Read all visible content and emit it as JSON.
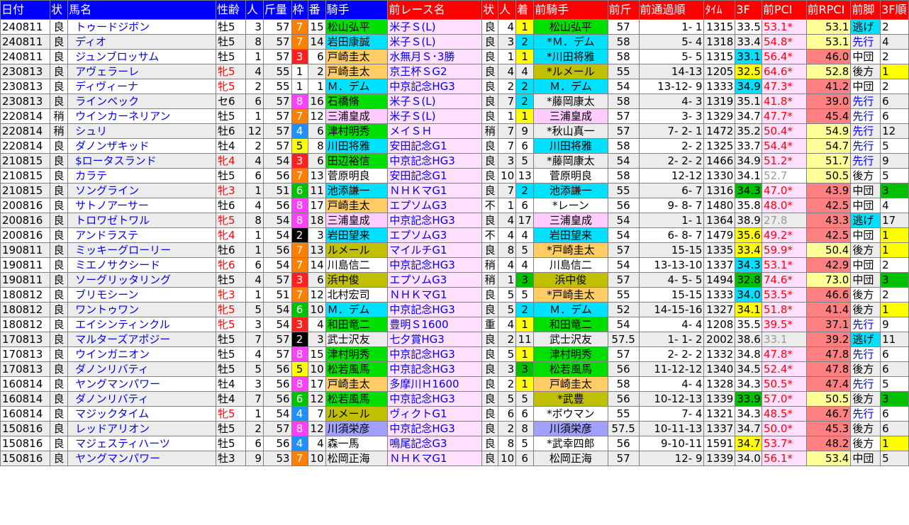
{
  "headers": [
    "日付",
    "状",
    "馬名",
    "性齢",
    "人",
    "斤量",
    "枠",
    "番",
    "騎手",
    "前レース名",
    "状",
    "人",
    "着",
    "前騎手",
    "前斤",
    "前通過順",
    "ﾀｲﾑ",
    "3F",
    "前PCI",
    "前RPCI",
    "前脚",
    "3F順"
  ],
  "rows": [
    {
      "date": "240811",
      "cond": "良",
      "name": "トゥードジボン",
      "age": "牡5",
      "mare": false,
      "pop": "3",
      "wt": "57",
      "frame": "7",
      "no": "15",
      "jockey": "松山弘平",
      "jc": "#00e000",
      "race": "米子Ｓ(L)",
      "pcond": "良",
      "ppop": "4",
      "fin": "1",
      "finc": "#ffff00",
      "pjockey": "松山弘平",
      "pjc": "#00e000",
      "pwt": "57",
      "pass": "1- 1",
      "time": "1315",
      "f3": "33.5",
      "f3c": "",
      "pci": "53.1*",
      "pcihi": true,
      "rpci": "53.1",
      "rpc": "#ffff99",
      "pos": "逃げ",
      "posc": "#00e0ff",
      "f3r": "2",
      "f3rc": ""
    },
    {
      "date": "240811",
      "cond": "良",
      "name": "ディオ",
      "age": "牡5",
      "mare": false,
      "pop": "8",
      "wt": "57",
      "frame": "7",
      "no": "14",
      "jockey": "岩田康誠",
      "jc": "#00e0ff",
      "race": "米子Ｓ(L)",
      "pcond": "良",
      "ppop": "3",
      "fin": "2",
      "finc": "#00e0ff",
      "pjockey": "*Ｍ．デム",
      "pjc": "#00e0ff",
      "pwt": "58",
      "pass": "5- 4",
      "time": "1318",
      "f3": "33.4",
      "f3c": "",
      "pci": "54.8*",
      "pcihi": true,
      "rpci": "53.1",
      "rpc": "#ffff99",
      "pos": "先行",
      "posc": "",
      "f3r": "4",
      "f3rc": ""
    },
    {
      "date": "240811",
      "cond": "良",
      "name": "ジュンブロッサム",
      "age": "牡5",
      "mare": false,
      "pop": "1",
      "wt": "57",
      "frame": "3",
      "no": "6",
      "jockey": "戸崎圭太",
      "jc": "#ffcc66",
      "race": "水無月Ｓ･3勝",
      "pcond": "良",
      "ppop": "1",
      "fin": "1",
      "finc": "#ffff00",
      "pjockey": "*川田将雅",
      "pjc": "#00e0ff",
      "pwt": "58",
      "pass": "5- 5",
      "time": "1315",
      "f3": "33.1",
      "f3c": "#00e0ff",
      "pci": "56.4*",
      "pcihi": true,
      "rpci": "46.0",
      "rpc": "#ff8080",
      "pos": "中団",
      "posc": "",
      "f3r": "2",
      "f3rc": ""
    },
    {
      "date": "230813",
      "cond": "良",
      "name": "アヴェラーレ",
      "age": "牝5",
      "mare": true,
      "pop": "4",
      "wt": "55",
      "frame": "1",
      "no": "2",
      "jockey": "戸崎圭太",
      "jc": "#ffcc66",
      "race": "京王杯ＳG2",
      "pcond": "良",
      "ppop": "4",
      "fin": "4",
      "finc": "",
      "pjockey": "*ルメール",
      "pjc": "#c0c000",
      "pwt": "55",
      "pass": "14-13",
      "time": "1205",
      "f3": "32.5",
      "f3c": "#ffff00",
      "pci": "64.6*",
      "pcihi": true,
      "rpci": "52.8",
      "rpc": "#ffff99",
      "pos": "後方",
      "posc": "",
      "f3r": "1",
      "f3rc": "#ffff00"
    },
    {
      "date": "230813",
      "cond": "良",
      "name": "ディヴィーナ",
      "age": "牝5",
      "mare": true,
      "pop": "2",
      "wt": "55",
      "frame": "1",
      "no": "1",
      "jockey": "Ｍ．デム",
      "jc": "#00e0ff",
      "race": "中京記念HG3",
      "pcond": "良",
      "ppop": "2",
      "fin": "2",
      "finc": "#00e0ff",
      "pjockey": "Ｍ．デム",
      "pjc": "#00e0ff",
      "pwt": "54",
      "pass": "13-12- 9",
      "time": "1333",
      "f3": "34.9",
      "f3c": "#00e0ff",
      "pci": "47.3*",
      "pcihi": true,
      "rpci": "41.2",
      "rpc": "#ff8080",
      "pos": "中団",
      "posc": "",
      "f3r": "2",
      "f3rc": ""
    },
    {
      "date": "230813",
      "cond": "良",
      "name": "ラインベック",
      "age": "セ6",
      "mare": false,
      "pop": "6",
      "wt": "57",
      "frame": "8",
      "no": "16",
      "jockey": "石橋脩",
      "jc": "#00e000",
      "race": "米子Ｓ(L)",
      "pcond": "良",
      "ppop": "7",
      "fin": "2",
      "finc": "#00e0ff",
      "pjockey": "*藤岡康太",
      "pjc": "",
      "pwt": "58",
      "pass": "4- 3",
      "time": "1319",
      "f3": "35.1",
      "f3c": "",
      "pci": "41.8*",
      "pcihi": true,
      "rpci": "39.0",
      "rpc": "#ff8080",
      "pos": "先行",
      "posc": "",
      "f3r": "6",
      "f3rc": ""
    },
    {
      "date": "220814",
      "cond": "稍",
      "name": "ウインカーネリアン",
      "age": "牡5",
      "mare": false,
      "pop": "1",
      "wt": "57",
      "frame": "7",
      "no": "12",
      "jockey": "三浦皇成",
      "jc": "#ffccff",
      "race": "米子Ｓ(L)",
      "pcond": "良",
      "ppop": "1",
      "fin": "1",
      "finc": "#ffff00",
      "pjockey": "三浦皇成",
      "pjc": "#ffccff",
      "pwt": "57",
      "pass": "3- 3",
      "time": "1329",
      "f3": "34.7",
      "f3c": "",
      "pci": "47.7*",
      "pcihi": true,
      "rpci": "45.4",
      "rpc": "#ff8080",
      "pos": "先行",
      "posc": "",
      "f3r": "6",
      "f3rc": ""
    },
    {
      "date": "220814",
      "cond": "稍",
      "name": "シュリ",
      "age": "牡6",
      "mare": false,
      "pop": "12",
      "wt": "57",
      "frame": "4",
      "no": "6",
      "jockey": "津村明秀",
      "jc": "#00e000",
      "race": "メイＳＨ",
      "pcond": "稍",
      "ppop": "7",
      "fin": "9",
      "finc": "",
      "pjockey": "*秋山真一",
      "pjc": "",
      "pwt": "57",
      "pass": "7- 2- 1",
      "time": "1472",
      "f3": "35.2",
      "f3c": "",
      "pci": "50.4*",
      "pcihi": true,
      "rpci": "54.9",
      "rpc": "#ffff99",
      "pos": "先行",
      "posc": "",
      "f3r": "12",
      "f3rc": ""
    },
    {
      "date": "220814",
      "cond": "良",
      "name": "ダノンザキッド",
      "age": "牡4",
      "mare": false,
      "pop": "2",
      "wt": "57",
      "frame": "5",
      "no": "8",
      "jockey": "川田将雅",
      "jc": "#00e0ff",
      "race": "安田記念G1",
      "pcond": "良",
      "ppop": "7",
      "fin": "6",
      "finc": "",
      "pjockey": "川田将雅",
      "pjc": "#00e0ff",
      "pwt": "58",
      "pass": "2- 2",
      "time": "1325",
      "f3": "33.7",
      "f3c": "",
      "pci": "54.4*",
      "pcihi": true,
      "rpci": "54.7",
      "rpc": "#ffff99",
      "pos": "先行",
      "posc": "",
      "f3r": "5",
      "f3rc": ""
    },
    {
      "date": "210815",
      "cond": "良",
      "name": "$ロータスランド",
      "age": "牝4",
      "mare": true,
      "pop": "4",
      "wt": "54",
      "frame": "3",
      "no": "6",
      "jockey": "田辺裕信",
      "jc": "#00e000",
      "race": "中京記念HG3",
      "pcond": "良",
      "ppop": "3",
      "fin": "5",
      "finc": "",
      "pjockey": "*藤岡康太",
      "pjc": "",
      "pwt": "54",
      "pass": "2- 2- 2",
      "time": "1466",
      "f3": "34.9",
      "f3c": "",
      "pci": "51.2*",
      "pcihi": true,
      "rpci": "51.7",
      "rpc": "#ffff99",
      "pos": "先行",
      "posc": "",
      "f3r": "9",
      "f3rc": ""
    },
    {
      "date": "210815",
      "cond": "良",
      "name": "カラテ",
      "age": "牡5",
      "mare": false,
      "pop": "6",
      "wt": "56",
      "frame": "7",
      "no": "13",
      "jockey": "菅原明良",
      "jc": "",
      "race": "安田記念G1",
      "pcond": "良",
      "ppop": "10",
      "fin": "13",
      "finc": "",
      "pjockey": "菅原明良",
      "pjc": "",
      "pwt": "58",
      "pass": "12-12",
      "time": "1330",
      "f3": "34.1",
      "f3c": "",
      "pci": "52.7",
      "pcihi": false,
      "rpci": "50.5",
      "rpc": "#ffff99",
      "pos": "後方",
      "posc": "",
      "f3r": "5",
      "f3rc": ""
    },
    {
      "date": "210815",
      "cond": "良",
      "name": "ソングライン",
      "age": "牝3",
      "mare": true,
      "pop": "1",
      "wt": "51",
      "frame": "6",
      "no": "11",
      "jockey": "池添謙一",
      "jc": "#00e0ff",
      "race": "ＮＨＫマG1",
      "pcond": "良",
      "ppop": "7",
      "fin": "2",
      "finc": "#00e0ff",
      "pjockey": "池添謙一",
      "pjc": "#00e0ff",
      "pwt": "55",
      "pass": "6- 7",
      "time": "1316",
      "f3": "34.3",
      "f3c": "#00c000",
      "pci": "47.0*",
      "pcihi": true,
      "rpci": "43.9",
      "rpc": "#ff8080",
      "pos": "中団",
      "posc": "",
      "f3r": "3",
      "f3rc": "#00c000"
    },
    {
      "date": "200816",
      "cond": "良",
      "name": "サトノアーサー",
      "age": "牡6",
      "mare": false,
      "pop": "4",
      "wt": "56",
      "frame": "8",
      "no": "17",
      "jockey": "戸崎圭太",
      "jc": "#ffcc66",
      "race": "エプソムG3",
      "pcond": "不",
      "ppop": "1",
      "fin": "6",
      "finc": "",
      "pjockey": "*レーン",
      "pjc": "",
      "pwt": "56",
      "pass": "9- 8- 7",
      "time": "1480",
      "f3": "35.8",
      "f3c": "",
      "pci": "48.0*",
      "pcihi": true,
      "rpci": "42.5",
      "rpc": "#ff8080",
      "pos": "中団",
      "posc": "",
      "f3r": "4",
      "f3rc": ""
    },
    {
      "date": "200816",
      "cond": "良",
      "name": "トロワゼトワル",
      "age": "牝5",
      "mare": true,
      "pop": "8",
      "wt": "54",
      "frame": "8",
      "no": "18",
      "jockey": "三浦皇成",
      "jc": "#ffccff",
      "race": "中京記念HG3",
      "pcond": "良",
      "ppop": "4",
      "fin": "17",
      "finc": "",
      "pjockey": "三浦皇成",
      "pjc": "#ffccff",
      "pwt": "54",
      "pass": "1- 1",
      "time": "1364",
      "f3": "38.9",
      "f3c": "",
      "pci": "27.8",
      "pcihi": false,
      "rpci": "43.3",
      "rpc": "#ff8080",
      "pos": "逃げ",
      "posc": "#00e0ff",
      "f3r": "17",
      "f3rc": ""
    },
    {
      "date": "200816",
      "cond": "良",
      "name": "アンドラステ",
      "age": "牝4",
      "mare": true,
      "pop": "1",
      "wt": "54",
      "frame": "2",
      "no": "3",
      "jockey": "岩田望来",
      "jc": "#00e0ff",
      "race": "エプソムG3",
      "pcond": "不",
      "ppop": "4",
      "fin": "4",
      "finc": "",
      "pjockey": "岩田望来",
      "pjc": "#00e0ff",
      "pwt": "54",
      "pass": "6- 8- 7",
      "time": "1479",
      "f3": "35.6",
      "f3c": "#ffff00",
      "pci": "49.2*",
      "pcihi": true,
      "rpci": "42.5",
      "rpc": "#ff8080",
      "pos": "中団",
      "posc": "",
      "f3r": "1",
      "f3rc": "#ffff00"
    },
    {
      "date": "190811",
      "cond": "良",
      "name": "ミッキーグローリー",
      "age": "牡6",
      "mare": false,
      "pop": "1",
      "wt": "56",
      "frame": "7",
      "no": "13",
      "jockey": "ルメール",
      "jc": "#c0c000",
      "race": "マイルチG1",
      "pcond": "良",
      "ppop": "8",
      "fin": "5",
      "finc": "",
      "pjockey": "*戸崎圭太",
      "pjc": "#ffcc66",
      "pwt": "57",
      "pass": "15-15",
      "time": "1335",
      "f3": "33.4",
      "f3c": "#ffff00",
      "pci": "59.9*",
      "pcihi": true,
      "rpci": "50.4",
      "rpc": "#ffff99",
      "pos": "後方",
      "posc": "",
      "f3r": "1",
      "f3rc": "#ffff00"
    },
    {
      "date": "190811",
      "cond": "良",
      "name": "ミエノサクシード",
      "age": "牝6",
      "mare": true,
      "pop": "6",
      "wt": "54",
      "frame": "7",
      "no": "14",
      "jockey": "川島信二",
      "jc": "",
      "race": "中京記念HG3",
      "pcond": "稍",
      "ppop": "4",
      "fin": "4",
      "finc": "",
      "pjockey": "川島信二",
      "pjc": "",
      "pwt": "54",
      "pass": "13-13-10",
      "time": "1337",
      "f3": "34.3",
      "f3c": "#00e0ff",
      "pci": "53.1*",
      "pcihi": true,
      "rpci": "42.9",
      "rpc": "#ff8080",
      "pos": "中団",
      "posc": "",
      "f3r": "2",
      "f3rc": ""
    },
    {
      "date": "190811",
      "cond": "良",
      "name": "ソーグリッタリング",
      "age": "牡5",
      "mare": false,
      "pop": "4",
      "wt": "57",
      "frame": "3",
      "no": "6",
      "jockey": "浜中俊",
      "jc": "#c0c000",
      "race": "エプソムG3",
      "pcond": "稍",
      "ppop": "1",
      "fin": "3",
      "finc": "#00c000",
      "pjockey": "浜中俊",
      "pjc": "#c0c000",
      "pwt": "57",
      "pass": "4- 5- 5",
      "time": "1494",
      "f3": "32.8",
      "f3c": "#00c000",
      "pci": "74.6*",
      "pcihi": true,
      "rpci": "73.0",
      "rpc": "#ffff99",
      "pos": "中団",
      "posc": "",
      "f3r": "3",
      "f3rc": "#00c000"
    },
    {
      "date": "180812",
      "cond": "良",
      "name": "ブリモシーン",
      "age": "牝3",
      "mare": true,
      "pop": "1",
      "wt": "51",
      "frame": "7",
      "no": "12",
      "jockey": "北村宏司",
      "jc": "",
      "race": "ＮＨＫマG1",
      "pcond": "良",
      "ppop": "5",
      "fin": "5",
      "finc": "",
      "pjockey": "*戸崎圭太",
      "pjc": "#ffcc66",
      "pwt": "55",
      "pass": "15-15",
      "time": "1333",
      "f3": "34.0",
      "f3c": "#00e0ff",
      "pci": "53.5*",
      "pcihi": true,
      "rpci": "46.6",
      "rpc": "#ff8080",
      "pos": "後方",
      "posc": "",
      "f3r": "2",
      "f3rc": ""
    },
    {
      "date": "180812",
      "cond": "良",
      "name": "ワントゥワン",
      "age": "牝5",
      "mare": true,
      "pop": "5",
      "wt": "54",
      "frame": "6",
      "no": "10",
      "jockey": "Ｍ．デム",
      "jc": "#00e0ff",
      "race": "中京記念HG3",
      "pcond": "良",
      "ppop": "5",
      "fin": "2",
      "finc": "#00e0ff",
      "pjockey": "Ｍ．デム",
      "pjc": "#00e0ff",
      "pwt": "52",
      "pass": "14-15-16",
      "time": "1327",
      "f3": "34.1",
      "f3c": "#ffff00",
      "pci": "51.8*",
      "pcihi": true,
      "rpci": "41.4",
      "rpc": "#ff8080",
      "pos": "後方",
      "posc": "",
      "f3r": "1",
      "f3rc": "#ffff00"
    },
    {
      "date": "180812",
      "cond": "良",
      "name": "エイシンティンクル",
      "age": "牝5",
      "mare": true,
      "pop": "3",
      "wt": "54",
      "frame": "3",
      "no": "4",
      "jockey": "和田竜二",
      "jc": "#00e000",
      "race": "豊明Ｓ1600",
      "pcond": "重",
      "ppop": "4",
      "fin": "1",
      "finc": "#ffff00",
      "pjockey": "和田竜二",
      "pjc": "#00e000",
      "pwt": "54",
      "pass": "4- 4",
      "time": "1208",
      "f3": "35.5",
      "f3c": "",
      "pci": "39.5*",
      "pcihi": true,
      "rpci": "37.1",
      "rpc": "#ff8080",
      "pos": "先行",
      "posc": "",
      "f3r": "9",
      "f3rc": ""
    },
    {
      "date": "170813",
      "cond": "良",
      "name": "マルターズアポジー",
      "age": "牡5",
      "mare": false,
      "pop": "7",
      "wt": "57",
      "frame": "2",
      "no": "3",
      "jockey": "武士沢友",
      "jc": "",
      "race": "七夕賞HG3",
      "pcond": "良",
      "ppop": "2",
      "fin": "11",
      "finc": "",
      "pjockey": "武士沢友",
      "pjc": "",
      "pwt": "57.5",
      "pass": "1- 1- 2",
      "time": "2002",
      "f3": "38.6",
      "f3c": "",
      "pci": "33.1",
      "pcihi": false,
      "rpci": "39.2",
      "rpc": "#ff8080",
      "pos": "逃げ",
      "posc": "#00e0ff",
      "f3r": "11",
      "f3rc": ""
    },
    {
      "date": "170813",
      "cond": "良",
      "name": "ウインガニオン",
      "age": "牡5",
      "mare": false,
      "pop": "4",
      "wt": "57",
      "frame": "8",
      "no": "15",
      "jockey": "津村明秀",
      "jc": "#00e000",
      "race": "中京記念HG3",
      "pcond": "良",
      "ppop": "5",
      "fin": "1",
      "finc": "#ffff00",
      "pjockey": "津村明秀",
      "pjc": "#00e000",
      "pwt": "57",
      "pass": "2- 2- 2",
      "time": "1332",
      "f3": "34.8",
      "f3c": "",
      "pci": "47.8*",
      "pcihi": true,
      "rpci": "47.8",
      "rpc": "#ff8080",
      "pos": "先行",
      "posc": "",
      "f3r": "6",
      "f3rc": ""
    },
    {
      "date": "170813",
      "cond": "良",
      "name": "ダノンリバティ",
      "age": "牡5",
      "mare": false,
      "pop": "5",
      "wt": "56",
      "frame": "5",
      "no": "10",
      "jockey": "松若風馬",
      "jc": "#00e000",
      "race": "中京記念HG3",
      "pcond": "良",
      "ppop": "3",
      "fin": "3",
      "finc": "#00c000",
      "pjockey": "松若風馬",
      "pjc": "#00e000",
      "pwt": "56",
      "pass": "11-12-12",
      "time": "1340",
      "f3": "34.5",
      "f3c": "",
      "pci": "52.4*",
      "pcihi": true,
      "rpci": "47.8",
      "rpc": "#ff8080",
      "pos": "後方",
      "posc": "",
      "f3r": "6",
      "f3rc": ""
    },
    {
      "date": "160814",
      "cond": "良",
      "name": "ヤングマンパワー",
      "age": "牡4",
      "mare": false,
      "pop": "3",
      "wt": "56",
      "frame": "8",
      "no": "17",
      "jockey": "戸崎圭太",
      "jc": "#ffcc66",
      "race": "多摩川Ｈ1600",
      "pcond": "良",
      "ppop": "2",
      "fin": "1",
      "finc": "#ffff00",
      "pjockey": "戸崎圭太",
      "pjc": "#ffcc66",
      "pwt": "58",
      "pass": "4- 4",
      "time": "1328",
      "f3": "34.3",
      "f3c": "",
      "pci": "50.5*",
      "pcihi": true,
      "rpci": "47.4",
      "rpc": "#ff8080",
      "pos": "先行",
      "posc": "",
      "f3r": "5",
      "f3rc": ""
    },
    {
      "date": "160814",
      "cond": "良",
      "name": "ダノンリバティ",
      "age": "牡4",
      "mare": false,
      "pop": "7",
      "wt": "56",
      "frame": "6",
      "no": "12",
      "jockey": "松若風馬",
      "jc": "#00e000",
      "race": "中京記念HG3",
      "pcond": "良",
      "ppop": "5",
      "fin": "5",
      "finc": "",
      "pjockey": "*武豊",
      "pjc": "#c0c000",
      "pwt": "56",
      "pass": "10-12-13",
      "time": "1339",
      "f3": "33.9",
      "f3c": "#00c000",
      "pci": "57.0*",
      "pcihi": true,
      "rpci": "50.5",
      "rpc": "#ffff99",
      "pos": "後方",
      "posc": "",
      "f3r": "3",
      "f3rc": "#00c000"
    },
    {
      "date": "160814",
      "cond": "良",
      "name": "マジックタイム",
      "age": "牝5",
      "mare": true,
      "pop": "1",
      "wt": "54",
      "frame": "4",
      "no": "7",
      "jockey": "ルメール",
      "jc": "#c0c000",
      "race": "ヴィクトG1",
      "pcond": "良",
      "ppop": "6",
      "fin": "6",
      "finc": "",
      "pjockey": "*ボウマン",
      "pjc": "",
      "pwt": "55",
      "pass": "7- 4",
      "time": "1321",
      "f3": "34.3",
      "f3c": "",
      "pci": "48.5*",
      "pcihi": true,
      "rpci": "46.7",
      "rpc": "#ff8080",
      "pos": "先行",
      "posc": "",
      "f3r": "6",
      "f3rc": ""
    },
    {
      "date": "150816",
      "cond": "良",
      "name": "レッドアリオン",
      "age": "牡5",
      "mare": false,
      "pop": "2",
      "wt": "57",
      "frame": "8",
      "no": "12",
      "jockey": "川須栄彦",
      "jc": "#a0a0ff",
      "race": "中京記念HG3",
      "pcond": "良",
      "ppop": "2",
      "fin": "8",
      "finc": "",
      "pjockey": "川須栄彦",
      "pjc": "#a0a0ff",
      "pwt": "57.5",
      "pass": "10-11-13",
      "time": "1337",
      "f3": "34.7",
      "f3c": "",
      "pci": "50.0*",
      "pcihi": true,
      "rpci": "45.3",
      "rpc": "#ff8080",
      "pos": "後方",
      "posc": "",
      "f3r": "6",
      "f3rc": ""
    },
    {
      "date": "150816",
      "cond": "良",
      "name": "マジェスティハーツ",
      "age": "牡5",
      "mare": false,
      "pop": "6",
      "wt": "56",
      "frame": "4",
      "no": "4",
      "jockey": "森一馬",
      "jc": "",
      "race": "鳴尾記念G3",
      "pcond": "良",
      "ppop": "8",
      "fin": "5",
      "finc": "",
      "pjockey": "*武幸四郎",
      "pjc": "",
      "pwt": "56",
      "pass": "9-10-11",
      "time": "1591",
      "f3": "34.7",
      "f3c": "#ffff00",
      "pci": "53.7*",
      "pcihi": true,
      "rpci": "48.2",
      "rpc": "#ff8080",
      "pos": "後方",
      "posc": "",
      "f3r": "1",
      "f3rc": "#ffff00"
    },
    {
      "date": "150816",
      "cond": "良",
      "name": "ヤングマンパワー",
      "age": "牡3",
      "mare": false,
      "pop": "9",
      "wt": "53",
      "frame": "7",
      "no": "10",
      "jockey": "松岡正海",
      "jc": "",
      "race": "ＮＨＫマG1",
      "pcond": "良",
      "ppop": "10",
      "fin": "6",
      "finc": "",
      "pjockey": "松岡正海",
      "pjc": "",
      "pwt": "57",
      "pass": "12- 9",
      "time": "1339",
      "f3": "34.0",
      "f3c": "",
      "pci": "56.1*",
      "pcihi": true,
      "rpci": "53.4",
      "rpc": "#ffff99",
      "pos": "中団",
      "posc": "",
      "f3r": "5",
      "f3rc": ""
    }
  ]
}
